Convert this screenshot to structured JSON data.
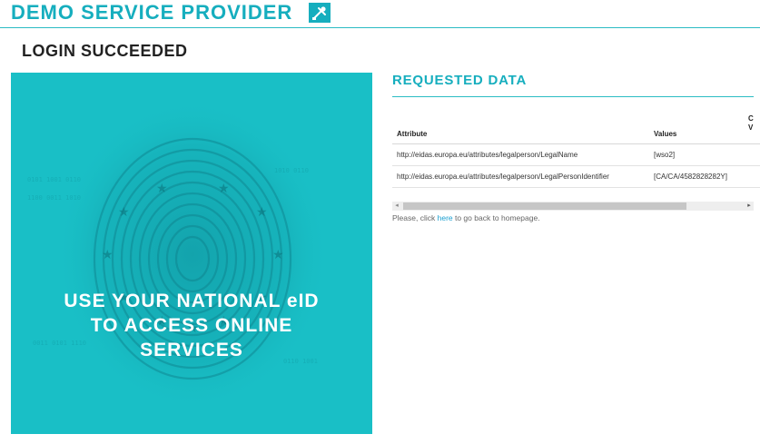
{
  "header": {
    "title": "DEMO SERVICE PROVIDER",
    "icon": "tools-icon",
    "accent_color": "#16aebe"
  },
  "page": {
    "title": "LOGIN SUCCEEDED"
  },
  "promo": {
    "lines": [
      "USE YOUR NATIONAL eID",
      "TO ACCESS ONLINE",
      "SERVICES"
    ],
    "background_color": "#19bfc6",
    "artwork": "fingerprint with EU stars"
  },
  "requested_data": {
    "title": "REQUESTED DATA",
    "columns": [
      "Attribute",
      "Values",
      "C\nV"
    ],
    "rows": [
      {
        "attribute": "http://eidas.europa.eu/attributes/legalperson/LegalName",
        "value": "[wso2]"
      },
      {
        "attribute": "http://eidas.europa.eu/attributes/legalperson/LegalPersonIdentifier",
        "value": "[CA/CA/4582828282Y]"
      }
    ],
    "scrollbar": {
      "left_arrow": "◂",
      "right_arrow": "▸"
    }
  },
  "back": {
    "prefix": "Please, click ",
    "link_text": "here",
    "suffix": " to go back to homepage."
  }
}
